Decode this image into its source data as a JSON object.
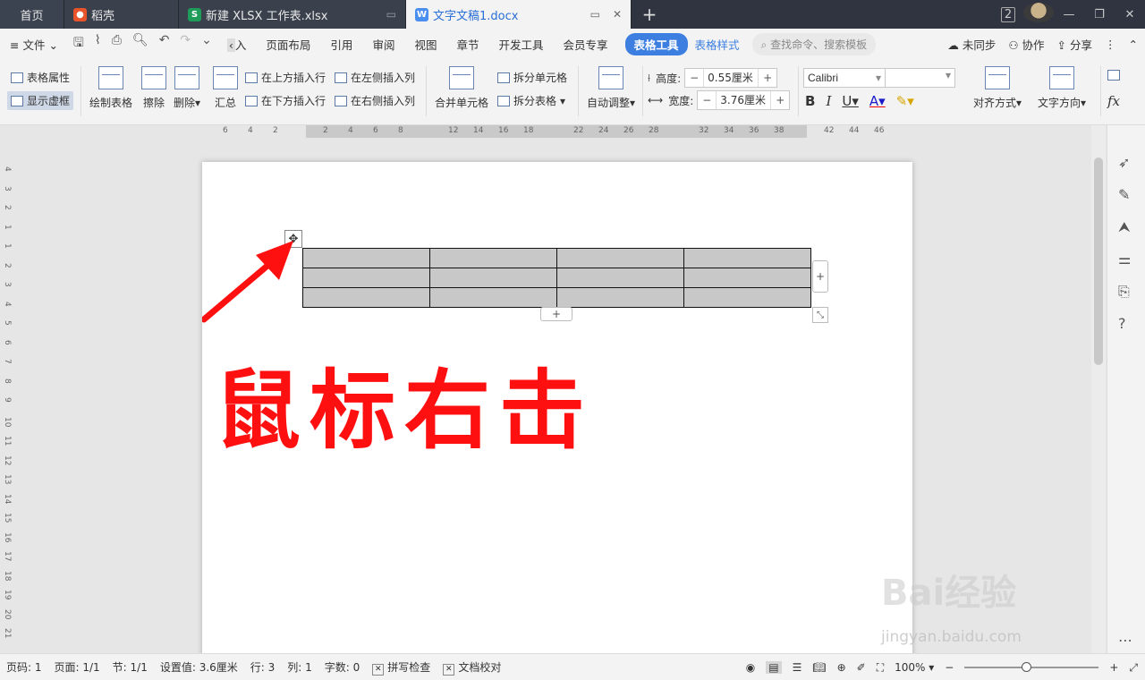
{
  "tabs": {
    "home": "首页",
    "daoke": "稻壳",
    "xlsx": "新建 XLSX 工作表.xlsx",
    "doc": "文字文稿1.docx",
    "add": "+",
    "badge": "2"
  },
  "menu": {
    "file": "文件",
    "insert": "入",
    "layout": "页面布局",
    "ref": "引用",
    "review": "审阅",
    "view": "视图",
    "chapter": "章节",
    "dev": "开发工具",
    "vip": "会员专享",
    "table_tools": "表格工具",
    "table_style": "表格样式",
    "search": "查找命令、搜索模板",
    "sync": "未同步",
    "collab": "协作",
    "share": "分享"
  },
  "ribbon": {
    "table_props": "表格属性",
    "show_gridlines": "显示虚框",
    "draw_table": "绘制表格",
    "erase": "擦除",
    "delete": "删除",
    "summary": "汇总",
    "insert_above": "在上方插入行",
    "insert_below": "在下方插入行",
    "insert_left": "在左侧插入列",
    "insert_right": "在右侧插入列",
    "merge": "合并单元格",
    "split_cell": "拆分单元格",
    "split_table": "拆分表格",
    "auto_fit": "自动调整",
    "height_label": "高度:",
    "height_value": "0.55厘米",
    "width_label": "宽度:",
    "width_value": "3.76厘米",
    "font": "Calibri",
    "align": "对齐方式",
    "text_dir": "文字方向"
  },
  "ruler": {
    "h_ticks": [
      "6",
      "4",
      "2",
      "2",
      "4",
      "6",
      "8",
      "12",
      "14",
      "16",
      "18",
      "22",
      "24",
      "26",
      "28",
      "32",
      "34",
      "36",
      "38",
      "42",
      "44",
      "46"
    ],
    "v_ticks": [
      "4",
      "3",
      "2",
      "1",
      "1",
      "2",
      "3",
      "4",
      "5",
      "6",
      "7",
      "8",
      "9",
      "10",
      "11",
      "12",
      "13",
      "14",
      "15",
      "16",
      "17",
      "18",
      "19",
      "20",
      "21"
    ]
  },
  "document": {
    "annotation": "鼠标右击",
    "rows": 3,
    "cols": 4
  },
  "status": {
    "page": "页码: 1",
    "pages": "页面: 1/1",
    "section": "节: 1/1",
    "setting": "设置值: 3.6厘米",
    "row": "行: 3",
    "col": "列: 1",
    "words": "字数: 0",
    "spell": "拼写检查",
    "proof": "文档校对",
    "zoom": "100%"
  },
  "watermark": {
    "brand": "Bai经验",
    "url": "jingyan.baidu.com"
  },
  "colors": {
    "accent": "#3d7fe0",
    "annotation": "#ff1010",
    "tab_bar": "#2f3440"
  }
}
